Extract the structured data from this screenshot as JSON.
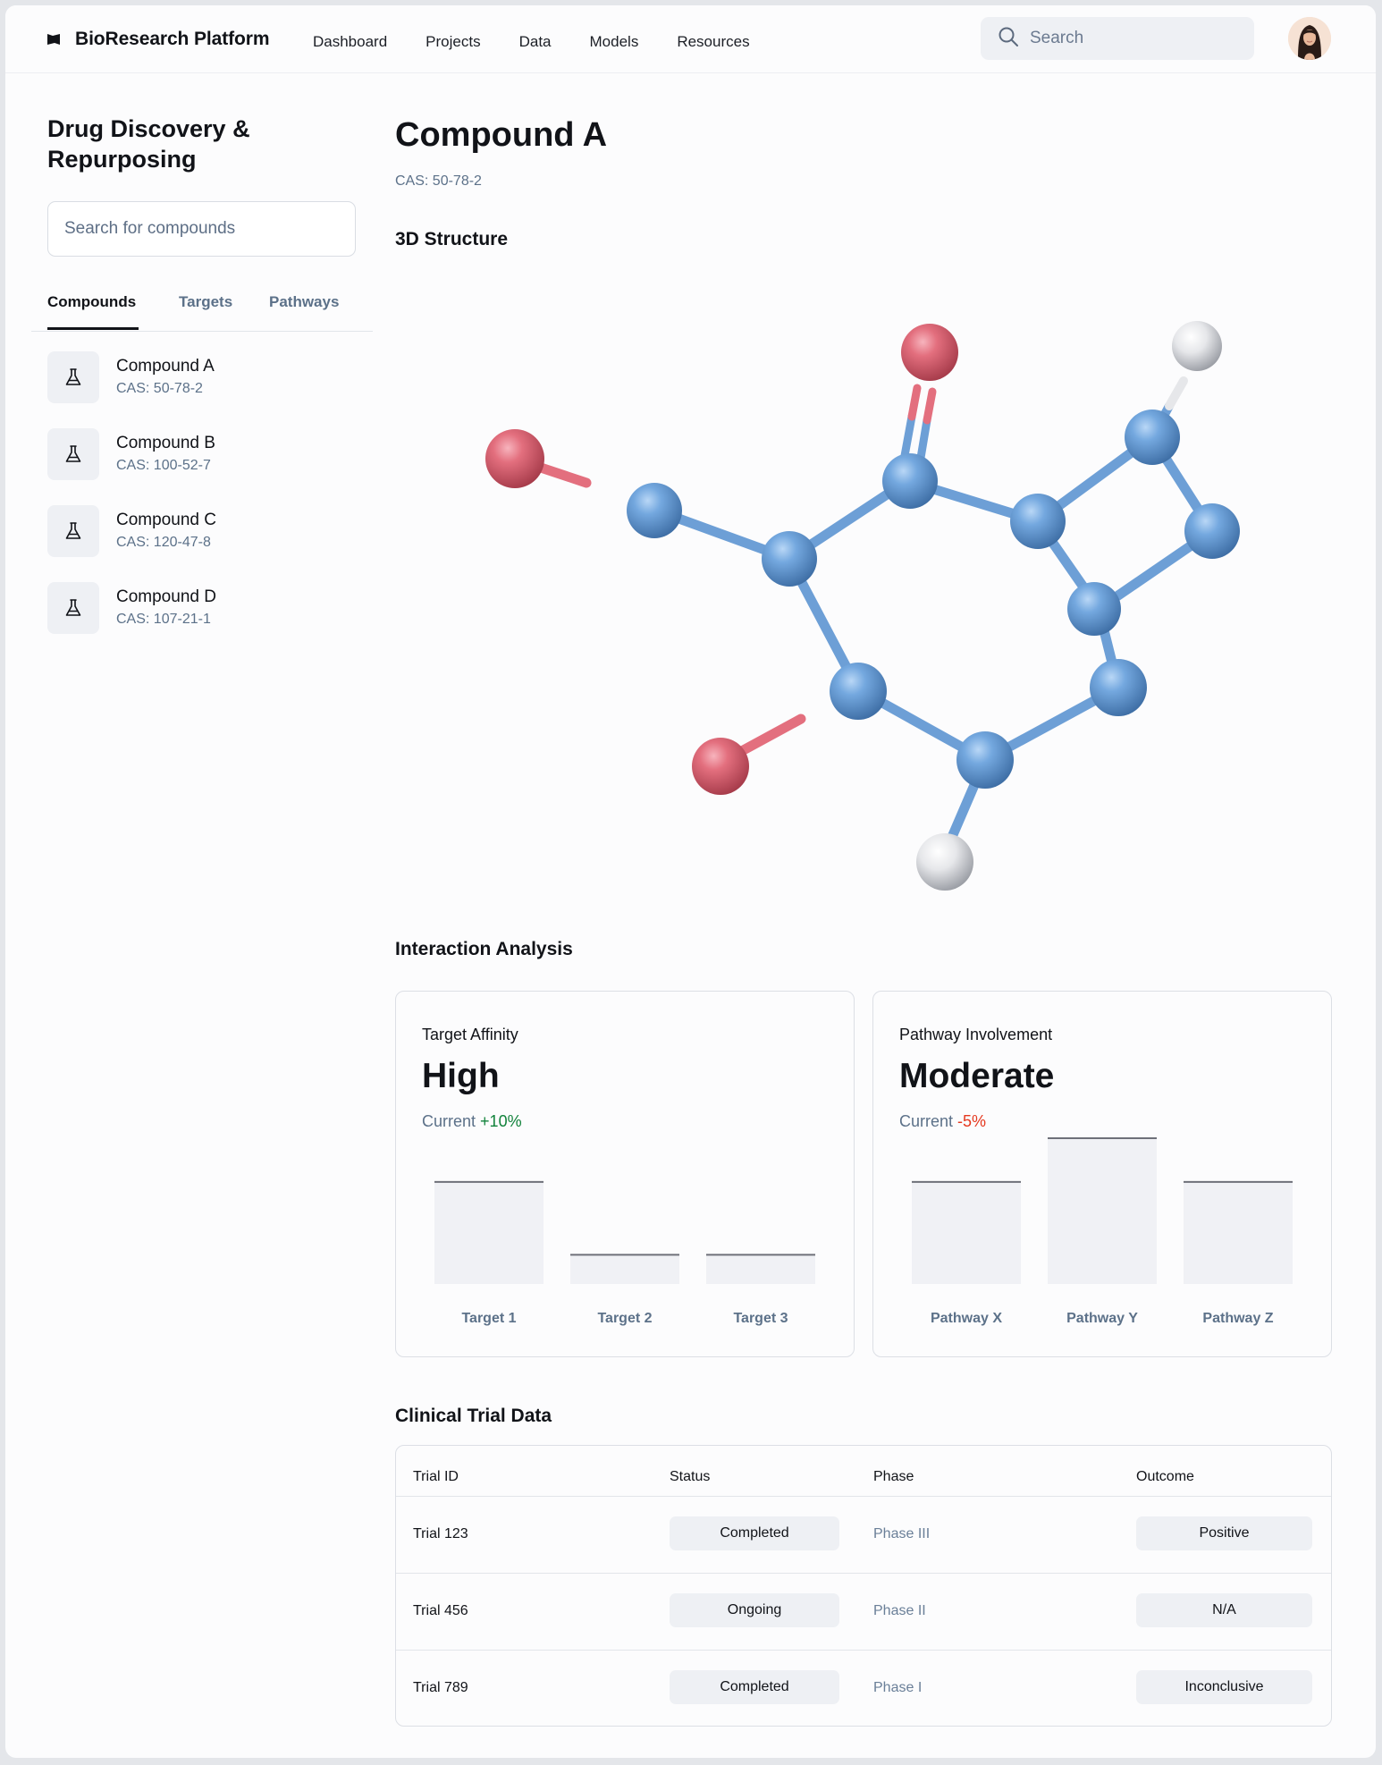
{
  "header": {
    "app_name": "BioResearch Platform",
    "nav": [
      "Dashboard",
      "Projects",
      "Data",
      "Models",
      "Resources"
    ],
    "search_placeholder": "Search"
  },
  "sidebar": {
    "title": "Drug Discovery & Repurposing",
    "search_placeholder": "Search for compounds",
    "tabs": [
      "Compounds",
      "Targets",
      "Pathways"
    ],
    "active_tab": "Compounds",
    "compounds": [
      {
        "name": "Compound A",
        "cas": "CAS: 50-78-2"
      },
      {
        "name": "Compound B",
        "cas": "CAS: 100-52-7"
      },
      {
        "name": "Compound C",
        "cas": "CAS: 120-47-8"
      },
      {
        "name": "Compound D",
        "cas": "CAS: 107-21-1"
      }
    ]
  },
  "compound": {
    "name": "Compound A",
    "cas": "CAS: 50-78-2"
  },
  "sections": {
    "structure": "3D Structure",
    "interaction": "Interaction Analysis",
    "trials": "Clinical Trial Data"
  },
  "cards": {
    "affinity": {
      "label": "Target Affinity",
      "value": "High",
      "delta_prefix": "Current",
      "delta": "+10%"
    },
    "pathway": {
      "label": "Pathway Involvement",
      "value": "Moderate",
      "delta_prefix": "Current",
      "delta": "-5%"
    }
  },
  "chart_data": [
    {
      "type": "bar",
      "categories": [
        "Target 1",
        "Target 2",
        "Target 3"
      ],
      "values": [
        70,
        20,
        20
      ],
      "ylim": [
        0,
        100
      ]
    },
    {
      "type": "bar",
      "categories": [
        "Pathway X",
        "Pathway Y",
        "Pathway Z"
      ],
      "values": [
        70,
        100,
        70
      ],
      "ylim": [
        0,
        100
      ]
    }
  ],
  "trials": {
    "columns": [
      "Trial ID",
      "Status",
      "Phase",
      "Outcome"
    ],
    "rows": [
      {
        "id": "Trial 123",
        "status": "Completed",
        "phase": "Phase III",
        "outcome": "Positive"
      },
      {
        "id": "Trial 456",
        "status": "Ongoing",
        "phase": "Phase II",
        "outcome": "N/A"
      },
      {
        "id": "Trial 789",
        "status": "Completed",
        "phase": "Phase I",
        "outcome": "Inconclusive"
      }
    ]
  },
  "colors": {
    "accent": "#111318",
    "muted": "#5c7189",
    "positive": "#11823b",
    "negative": "#e5381f",
    "bar_fill": "#f0f1f5",
    "bar_line": "#6e7079",
    "carbon_atom": "#6a9fd8",
    "oxygen_atom": "#e06a78",
    "hydrogen_atom": "#e8e8ea"
  }
}
